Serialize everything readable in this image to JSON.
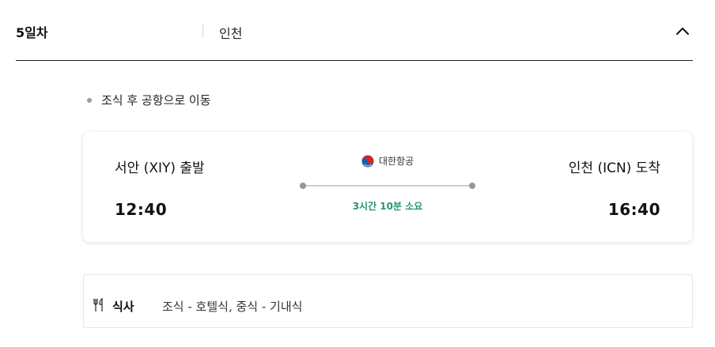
{
  "day": {
    "label": "5일차",
    "city": "인천"
  },
  "schedule": {
    "items": [
      {
        "text": "조식 후 공항으로 이동"
      }
    ]
  },
  "flight": {
    "departure_label": "서안 (XIY) 출발",
    "departure_time": "12:40",
    "arrival_label": "인천 (ICN) 도착",
    "arrival_time": "16:40",
    "airline": "대한항공",
    "airline_icon": "korean-air-logo-icon",
    "duration": "3시간 10분 소요",
    "colors": {
      "duration_text": "#23967a",
      "route_dot": "#8f9a96",
      "route_line": "#c8cfcc"
    }
  },
  "meal": {
    "icon": "fork-knife-icon",
    "label": "식사",
    "value": "조식 - 호텔식, 중식 - 기내식"
  }
}
